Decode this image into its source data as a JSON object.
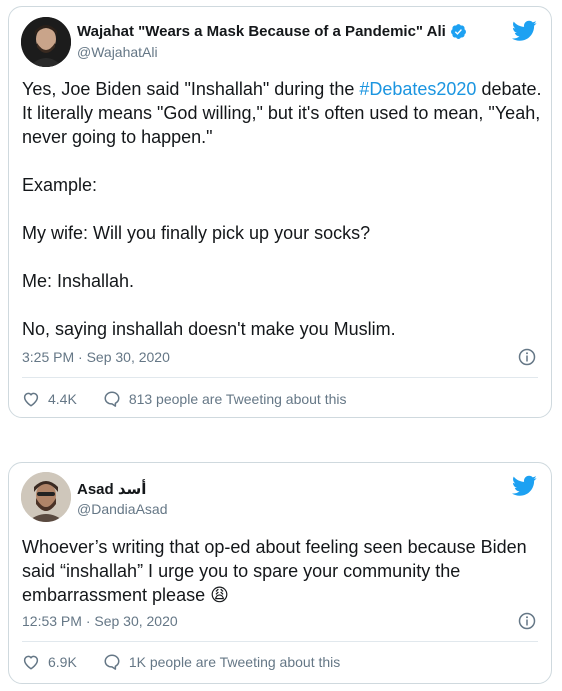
{
  "tweets": [
    {
      "display_name": "Wajahat \"Wears a Mask Because of a Pandemic\" Ali",
      "handle": "@WajahatAli",
      "verified": true,
      "text": {
        "p1_pre": "Yes, Joe Biden said \"Inshallah\" during the ",
        "p1_hashtag": "#Debates2020",
        "p1_post": " debate. It literally means \"God willing,\" but it's often used to mean, \"Yeah, never going to happen.\"",
        "p2": "Example:",
        "p3": "My wife: Will you finally pick up your socks?",
        "p4": "Me: Inshallah.",
        "p5": "No, saying inshallah doesn't make you Muslim."
      },
      "timestamp": "3:25 PM · Sep 30, 2020",
      "likes": "4.4K",
      "tweeting_about": "813 people are Tweeting about this"
    },
    {
      "display_name": "Asad أسد",
      "handle": "@DandiaAsad",
      "verified": false,
      "text": {
        "p1": "Whoever’s writing that op-ed about feeling seen because Biden said “inshallah” I urge you to spare your community the embarrassment please",
        "emoji": "😩"
      },
      "timestamp": "12:53 PM · Sep 30, 2020",
      "likes": "6.9K",
      "tweeting_about": "1K people are Tweeting about this"
    }
  ],
  "icons": {
    "brand": "twitter-bird-icon",
    "verified": "verified-badge-icon",
    "info": "info-icon",
    "like": "heart-icon",
    "reply": "speech-bubble-icon"
  },
  "colors": {
    "brand_blue": "#1da1f2",
    "link_blue": "#1b95e0",
    "muted_gray": "#657786",
    "border": "#cfd9de"
  }
}
